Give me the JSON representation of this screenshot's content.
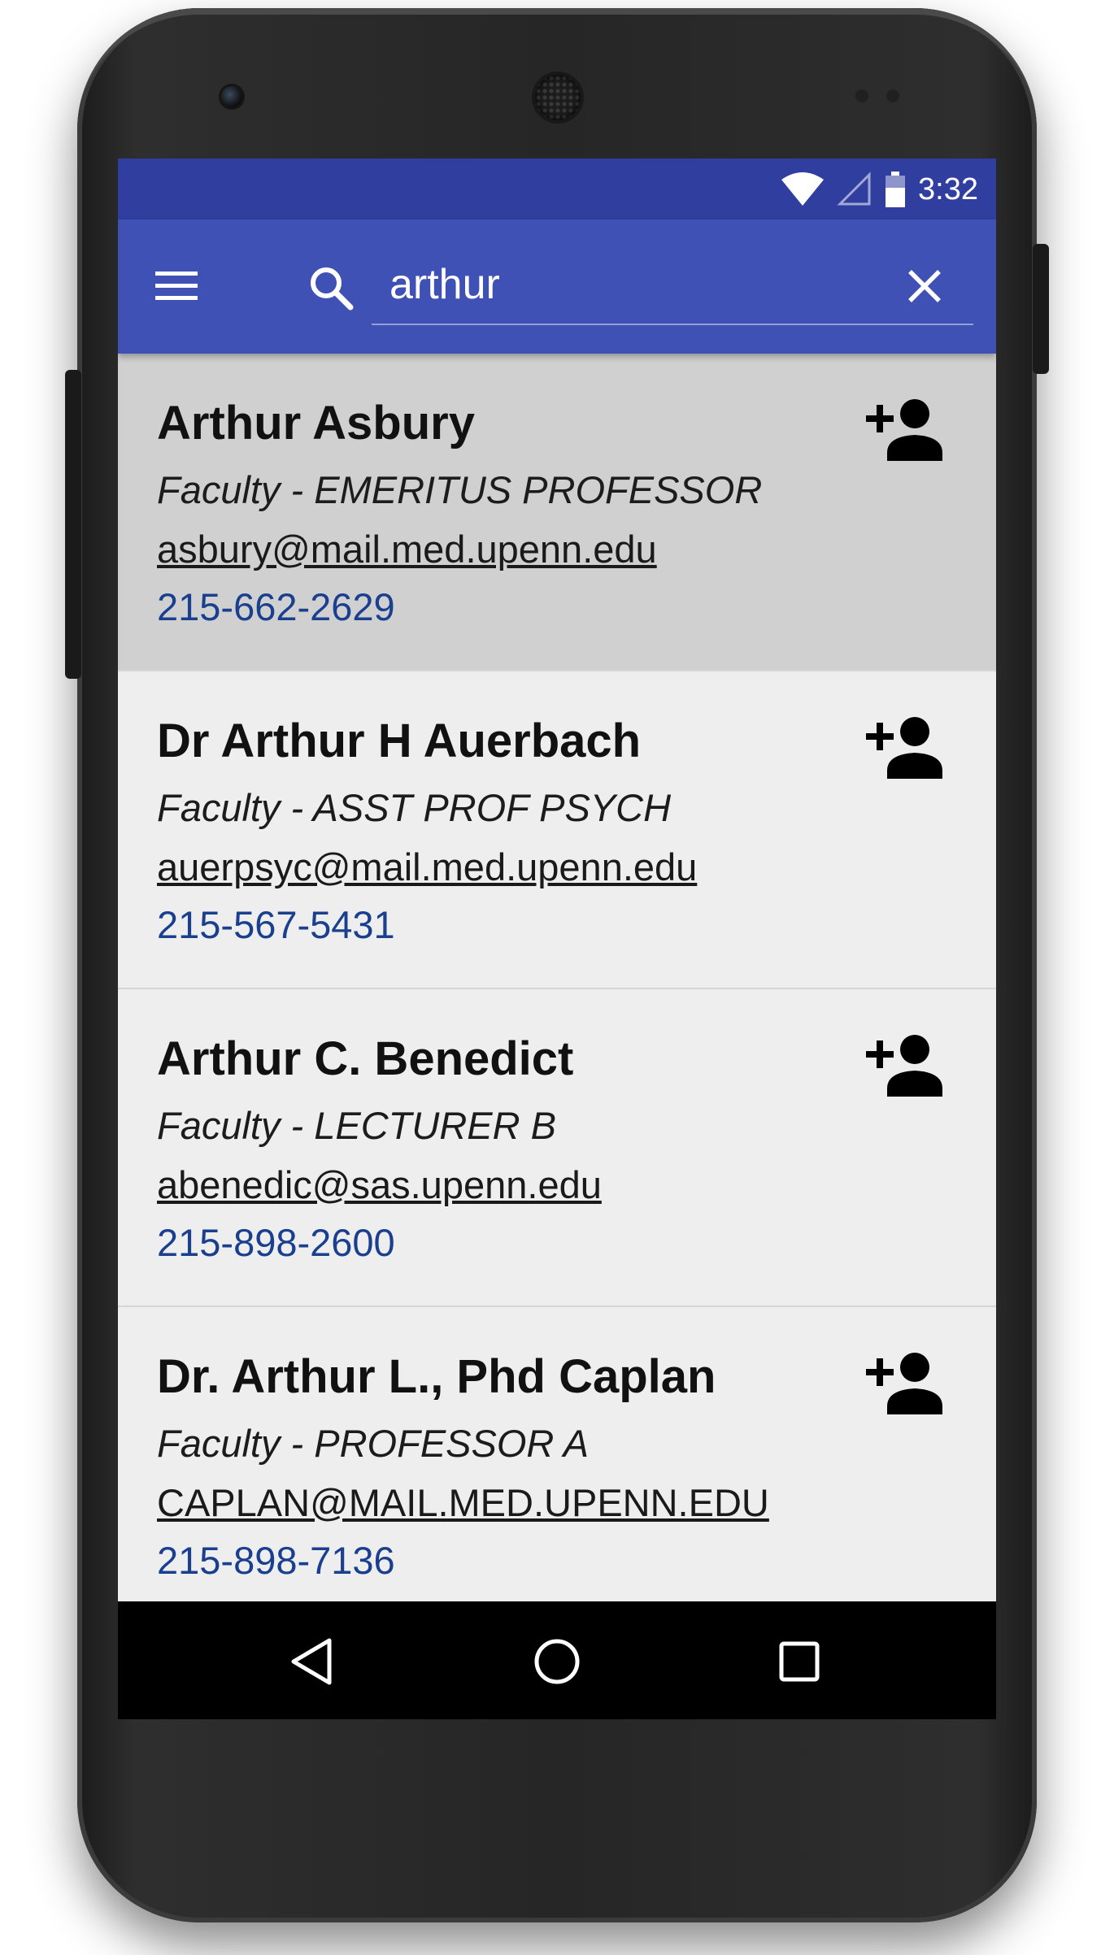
{
  "status_bar": {
    "time": "3:32",
    "icons": [
      "wifi-icon",
      "cell-signal-icon",
      "battery-icon"
    ]
  },
  "app_bar": {
    "menu_icon": "menu-icon",
    "search_icon": "search-icon",
    "search_query": "arthur",
    "clear_icon": "close-icon"
  },
  "results": [
    {
      "name": "Arthur Asbury",
      "title": "Faculty - EMERITUS PROFESSOR",
      "email": "asbury@mail.med.upenn.edu",
      "phone": "215-662-2629",
      "action_icon": "add-contact-icon",
      "selected": true
    },
    {
      "name": "Dr Arthur H Auerbach",
      "title": "Faculty - ASST PROF PSYCH",
      "email": "auerpsyc@mail.med.upenn.edu",
      "phone": "215-567-5431",
      "action_icon": "add-contact-icon",
      "selected": false
    },
    {
      "name": "Arthur C. Benedict",
      "title": "Faculty - LECTURER B",
      "email": "abenedic@sas.upenn.edu",
      "phone": "215-898-2600",
      "action_icon": "add-contact-icon",
      "selected": false
    },
    {
      "name": "Dr. Arthur L., Phd Caplan",
      "title": "Faculty - PROFESSOR A",
      "email": "CAPLAN@MAIL.MED.UPENN.EDU",
      "phone": "215-898-7136",
      "action_icon": "add-contact-icon",
      "selected": false
    }
  ],
  "nav_bar": {
    "buttons": [
      "back-icon",
      "home-icon",
      "recents-icon"
    ]
  },
  "colors": {
    "status_bar": "#303f9f",
    "app_bar": "#3f51b5",
    "list_background": "#eeeeee",
    "selected_row": "#d0d0d0",
    "phone_link": "#1a3f8f"
  }
}
